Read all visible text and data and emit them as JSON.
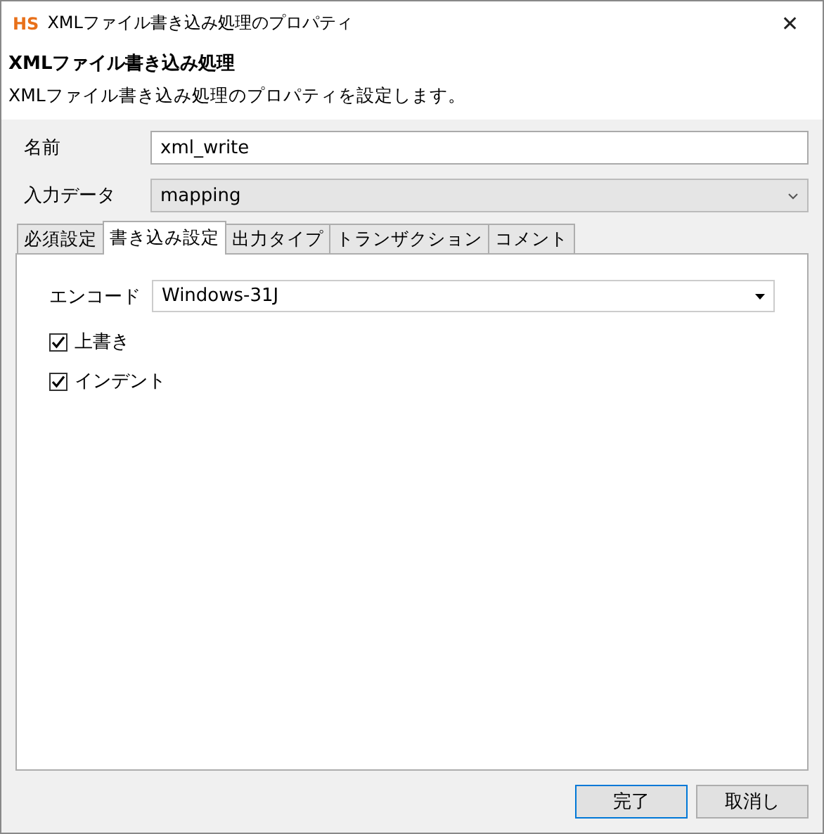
{
  "window": {
    "logo": "HS",
    "title": "XMLファイル書き込み処理のプロパティ",
    "close": "✕"
  },
  "header": {
    "title": "XMLファイル書き込み処理",
    "description": "XMLファイル書き込み処理のプロパティを設定します。"
  },
  "fields": [
    {
      "kind": "text",
      "label": "名前",
      "value": "xml_write"
    },
    {
      "kind": "select",
      "label": "入力データ",
      "value": "mapping"
    }
  ],
  "tabs": [
    {
      "label": "必須設定",
      "selected": false
    },
    {
      "label": "書き込み設定",
      "selected": true
    },
    {
      "label": "出力タイプ",
      "selected": false
    },
    {
      "label": "トランザクション",
      "selected": false
    },
    {
      "label": "コメント",
      "selected": false
    }
  ],
  "panel": {
    "encoding": {
      "label": "エンコード",
      "value": "Windows-31J"
    },
    "options": [
      {
        "label": "上書き",
        "checked": true
      },
      {
        "label": "インデント",
        "checked": true
      }
    ]
  },
  "buttons": [
    {
      "label": "完了",
      "default": true
    },
    {
      "label": "取消し",
      "default": false
    }
  ]
}
